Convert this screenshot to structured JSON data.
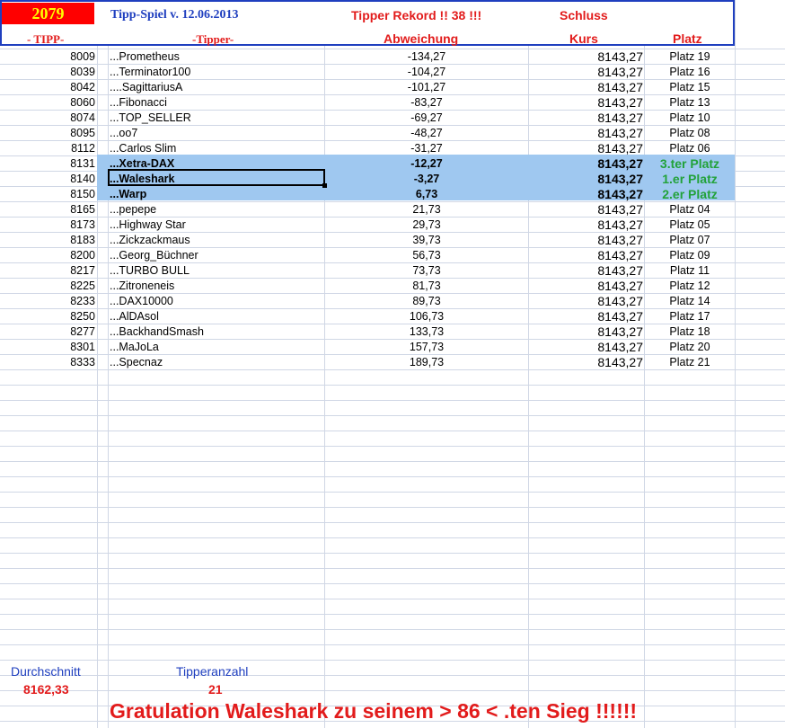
{
  "header": {
    "year_badge": "2079",
    "title": "Tipp-Spiel v. 12.06.2013",
    "record": "Tipper Rekord !!  38  !!!",
    "schluss": "Schluss",
    "col_tipp": "- TIPP-",
    "col_tipper": "-Tipper-",
    "col_abweichung": "Abweichung",
    "col_kurs": "Kurs",
    "col_platz": "Platz"
  },
  "rows": [
    {
      "tipp": "8009",
      "tipper": "...Prometheus",
      "abw": "-134,27",
      "kurs": "8143,27",
      "platz": "Platz 19"
    },
    {
      "tipp": "8039",
      "tipper": "...Terminator100",
      "abw": "-104,27",
      "kurs": "8143,27",
      "platz": "Platz 16"
    },
    {
      "tipp": "8042",
      "tipper": "....SagittariusA",
      "abw": "-101,27",
      "kurs": "8143,27",
      "platz": "Platz 15"
    },
    {
      "tipp": "8060",
      "tipper": "...Fibonacci",
      "abw": "-83,27",
      "kurs": "8143,27",
      "platz": "Platz 13"
    },
    {
      "tipp": "8074",
      "tipper": "...TOP_SELLER",
      "abw": "-69,27",
      "kurs": "8143,27",
      "platz": "Platz 10"
    },
    {
      "tipp": "8095",
      "tipper": "...oo7",
      "abw": "-48,27",
      "kurs": "8143,27",
      "platz": "Platz 08"
    },
    {
      "tipp": "8112",
      "tipper": "...Carlos Slim",
      "abw": "-31,27",
      "kurs": "8143,27",
      "platz": "Platz 06"
    },
    {
      "tipp": "8131",
      "tipper": "...Xetra-DAX",
      "abw": "-12,27",
      "kurs": "8143,27",
      "platz": "3.ter Platz"
    },
    {
      "tipp": "8140",
      "tipper": "...Waleshark",
      "abw": "-3,27",
      "kurs": "8143,27",
      "platz": "1.er Platz"
    },
    {
      "tipp": "8150",
      "tipper": "...Warp",
      "abw": "6,73",
      "kurs": "8143,27",
      "platz": "2.er Platz"
    },
    {
      "tipp": "8165",
      "tipper": "...pepepe",
      "abw": "21,73",
      "kurs": "8143,27",
      "platz": "Platz 04"
    },
    {
      "tipp": "8173",
      "tipper": "...Highway Star",
      "abw": "29,73",
      "kurs": "8143,27",
      "platz": "Platz 05"
    },
    {
      "tipp": "8183",
      "tipper": "...Zickzackmaus",
      "abw": "39,73",
      "kurs": "8143,27",
      "platz": "Platz 07"
    },
    {
      "tipp": "8200",
      "tipper": "...Georg_Büchner",
      "abw": "56,73",
      "kurs": "8143,27",
      "platz": "Platz 09"
    },
    {
      "tipp": "8217",
      "tipper": "...TURBO BULL",
      "abw": "73,73",
      "kurs": "8143,27",
      "platz": "Platz 11"
    },
    {
      "tipp": "8225",
      "tipper": "...Zitroneneis",
      "abw": "81,73",
      "kurs": "8143,27",
      "platz": "Platz 12"
    },
    {
      "tipp": "8233",
      "tipper": "...DAX10000",
      "abw": "89,73",
      "kurs": "8143,27",
      "platz": "Platz 14"
    },
    {
      "tipp": "8250",
      "tipper": "...AlDAsol",
      "abw": "106,73",
      "kurs": "8143,27",
      "platz": "Platz 17"
    },
    {
      "tipp": "8277",
      "tipper": "...BackhandSmash",
      "abw": "133,73",
      "kurs": "8143,27",
      "platz": "Platz 18"
    },
    {
      "tipp": "8301",
      "tipper": "...MaJoLa",
      "abw": "157,73",
      "kurs": "8143,27",
      "platz": "Platz 20"
    },
    {
      "tipp": "8333",
      "tipper": "...Specnaz",
      "abw": "189,73",
      "kurs": "8143,27",
      "platz": "Platz 21"
    }
  ],
  "footer": {
    "avg_label": "Durchschnitt",
    "avg_value": "8162,33",
    "count_label": "Tipperanzahl",
    "count_value": "21",
    "banner": "Gratulation Waleshark  zu seinem > 86 < .ten Sieg !!!!!!"
  },
  "colors": {
    "highlight": "#9fc8f0",
    "accent_red": "#e21b1b",
    "accent_blue": "#1f3fbf",
    "podium_green": "#22a23a"
  }
}
